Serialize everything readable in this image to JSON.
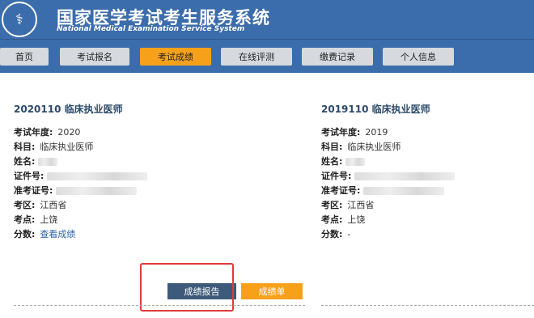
{
  "header": {
    "title_cn": "国家医学考试考生服务系统",
    "title_en": "National Medical Examination Service System"
  },
  "nav": [
    "首页",
    "考试报名",
    "考试成绩",
    "在线评测",
    "缴费记录",
    "个人信息"
  ],
  "active_nav": "考试成绩",
  "card1": {
    "title": "2020110  临床执业医师",
    "labels": {
      "year": "考试年度:",
      "subject": "科目:",
      "name": "姓名:",
      "id": "证件号:",
      "ticket": "准考证号:",
      "region": "考区:",
      "site": "考点:",
      "score": "分数:"
    },
    "values": {
      "year": "2020",
      "subject": "临床执业医师",
      "region": "江西省",
      "site": "上饶",
      "score": "查看成绩"
    }
  },
  "card2": {
    "title": "2019110  临床执业医师",
    "labels": {
      "year": "考试年度:",
      "subject": "科目:",
      "name": "姓名:",
      "id": "证件号:",
      "ticket": "准考证号:",
      "region": "考区:",
      "site": "考点:",
      "score": "分数:"
    },
    "values": {
      "year": "2019",
      "subject": "临床执业医师",
      "region": "江西省",
      "site": "上饶",
      "score": "-"
    }
  },
  "buttons": {
    "report": "成绩报告",
    "score_sheet": "成绩单"
  },
  "colors": {
    "header": "#3b6cab",
    "active": "#f7a11b",
    "report_btn": "#3d5a7a",
    "highlight": "#e23a3a"
  }
}
